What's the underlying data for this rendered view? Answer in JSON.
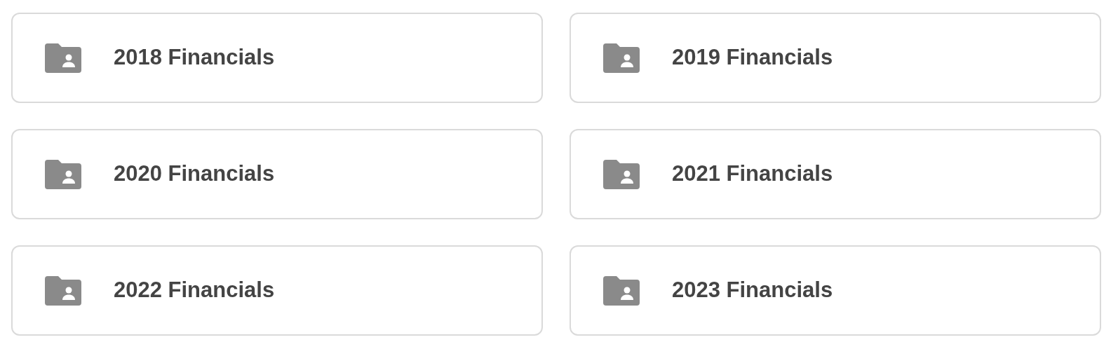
{
  "folders": [
    {
      "name": "2018 Financials"
    },
    {
      "name": "2019 Financials"
    },
    {
      "name": "2020 Financials"
    },
    {
      "name": "2021 Financials"
    },
    {
      "name": "2022 Financials"
    },
    {
      "name": "2023 Financials"
    }
  ]
}
